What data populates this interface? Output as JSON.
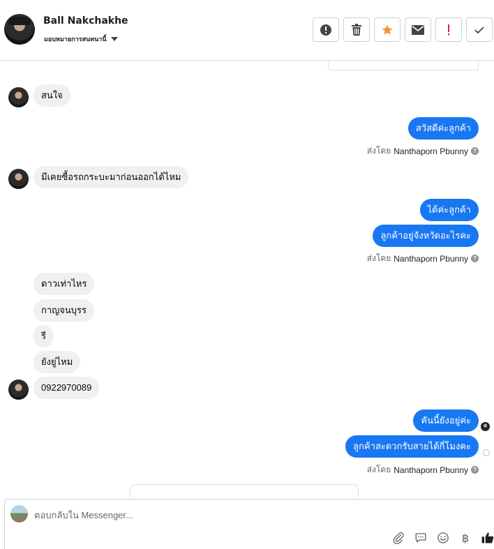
{
  "header": {
    "name": "Ball Nakchakhe",
    "assign_label": "มอบหมายการสนทนานี้",
    "actions": [
      {
        "name": "report-spam-button",
        "icon": "alert-circle-icon"
      },
      {
        "name": "delete-button",
        "icon": "trash-icon"
      },
      {
        "name": "star-button",
        "icon": "star-icon",
        "color": "#f7923b"
      },
      {
        "name": "mark-unread-button",
        "icon": "envelope-icon"
      },
      {
        "name": "follow-up-button",
        "icon": "exclamation-icon",
        "color": "#e41e3f"
      },
      {
        "name": "mark-done-button",
        "icon": "checkmark-icon"
      }
    ]
  },
  "messages": {
    "m1": "สนใจ",
    "m2": "สวัสดีค่ะลูกค้า",
    "m3": "มีเคยซื้อรถกระบะมาก่อนออกได้ไหม",
    "m4": "ได้ค่ะลูกค้า",
    "m5": "ลูกค้าอยู่จังหวัดอะไรคะ",
    "m6": "ดาวเท่าไหร",
    "m7": "กาญจนบุรร",
    "m8": "รี",
    "m9": "ยังยู่ไหม",
    "m10": "0922970089",
    "m11": "คันนี้ยังอยู่ค่ะ",
    "m12": "ลูกค้าสะดวกรับสายได้กี่โมงคะ"
  },
  "sent_by": {
    "prefix": "ส่งโดย",
    "agent": "Nanthaporn Pbunny"
  },
  "composer": {
    "placeholder": "ตอบกลับใน Messenger...",
    "tools": [
      "attachment-icon",
      "saved-reply-icon",
      "emoji-icon",
      "baht-icon",
      "thumbs-up-icon"
    ],
    "baht_symbol": "฿"
  },
  "colors": {
    "outgoing": "#1877f2",
    "incoming": "#f0f0f0",
    "star": "#f7923b",
    "alert": "#e41e3f"
  }
}
